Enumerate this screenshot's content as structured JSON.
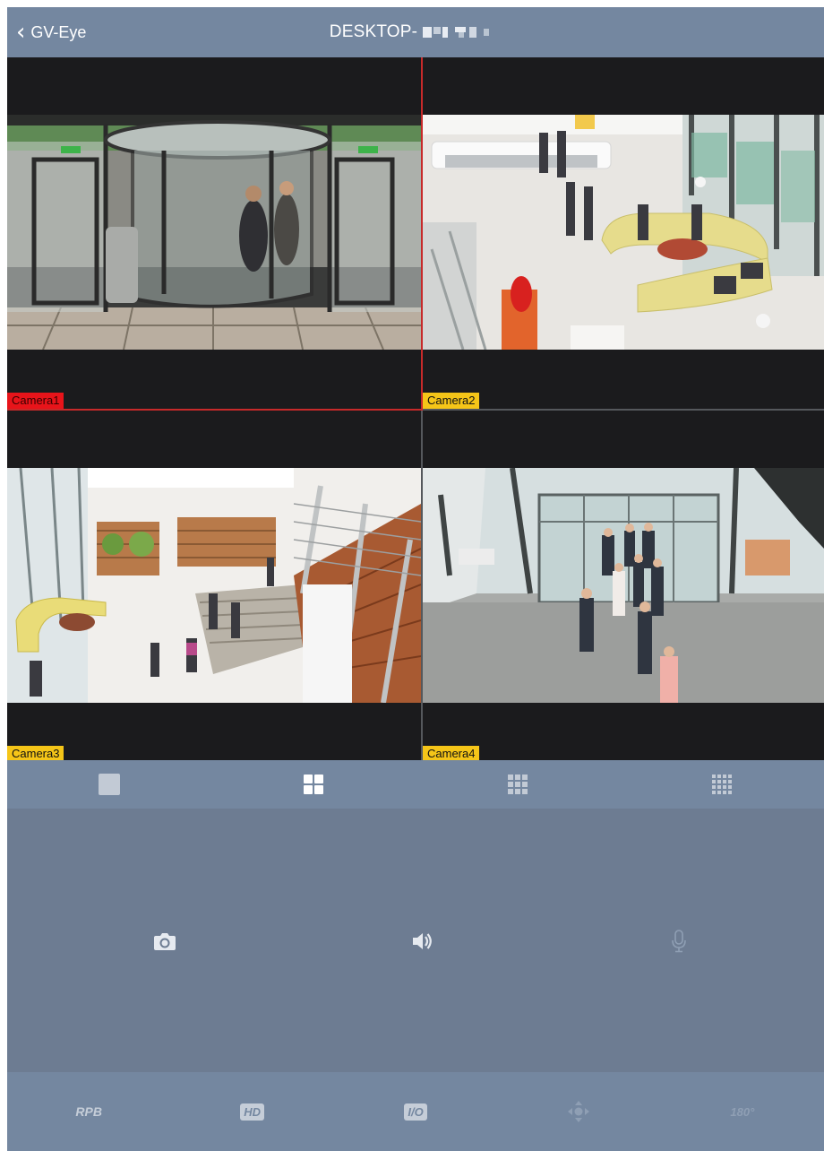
{
  "header": {
    "back_label": "GV-Eye",
    "title": "DESKTOP-"
  },
  "cameras": [
    {
      "label": "Camera1",
      "selected": true
    },
    {
      "label": "Camera2",
      "selected": false
    },
    {
      "label": "Camera3",
      "selected": false
    },
    {
      "label": "Camera4",
      "selected": false
    }
  ],
  "layouts": [
    "single-view-icon",
    "quad-view-icon",
    "nine-view-icon",
    "sixteen-view-icon"
  ],
  "controls": [
    "snapshot-camera-icon",
    "speaker-icon",
    "microphone-icon"
  ],
  "toolbar": {
    "rpb": "RPB",
    "hd": "HD",
    "io": "I/O",
    "ptz": "ptz-arrows-icon",
    "fisheye": "180°"
  },
  "colors": {
    "header_bg": "#7487a0",
    "panel_bg": "#6d7c92",
    "video_bg": "#1b1b1d",
    "selected_border": "#c72a2a",
    "camera_label_active": "#e8141a",
    "camera_label": "#f5c518"
  }
}
